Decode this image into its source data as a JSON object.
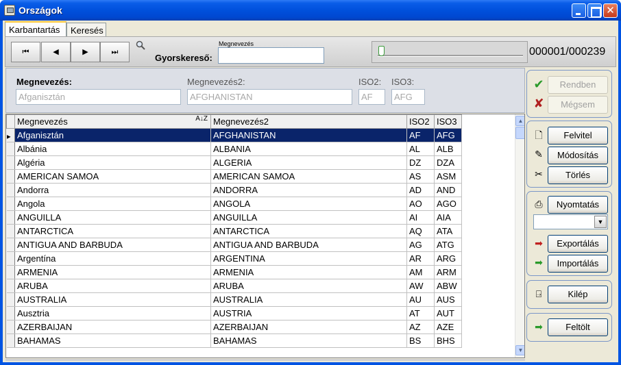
{
  "window": {
    "title": "Országok",
    "colors": {
      "titlebar": "#0054e3",
      "selection": "#0a246a"
    }
  },
  "tabs": [
    {
      "label": "Karbantartás",
      "active": true
    },
    {
      "label": "Keresés",
      "active": false
    }
  ],
  "toolbar": {
    "nav": {
      "first": "⏮",
      "prev": "◀",
      "next": "▶",
      "last": "⏭"
    },
    "search_label": "Gyorskereső:",
    "search_caption": "Megnevezés",
    "search_value": "",
    "record_counter": "000001/000239"
  },
  "detail": {
    "name_label": "Megnevezés:",
    "name_value": "Afganisztán",
    "name2_label": "Megnevezés2:",
    "name2_value": "AFGHANISTAN",
    "iso2_label": "ISO2:",
    "iso2_value": "AF",
    "iso3_label": "ISO3:",
    "iso3_value": "AFG"
  },
  "grid": {
    "columns": [
      "Megnevezés",
      "Megnevezés2",
      "ISO2",
      "ISO3"
    ],
    "sort_icon": "A↓Z",
    "selected_row": 0,
    "rows": [
      [
        "Afganisztán",
        "AFGHANISTAN",
        "AF",
        "AFG"
      ],
      [
        "Albánia",
        "ALBANIA",
        "AL",
        "ALB"
      ],
      [
        "Algéria",
        "ALGERIA",
        "DZ",
        "DZA"
      ],
      [
        "AMERICAN SAMOA",
        "AMERICAN SAMOA",
        "AS",
        "ASM"
      ],
      [
        "Andorra",
        "ANDORRA",
        "AD",
        "AND"
      ],
      [
        "Angola",
        "ANGOLA",
        "AO",
        "AGO"
      ],
      [
        "ANGUILLA",
        "ANGUILLA",
        "AI",
        "AIA"
      ],
      [
        "ANTARCTICA",
        "ANTARCTICA",
        "AQ",
        "ATA"
      ],
      [
        "ANTIGUA AND BARBUDA",
        "ANTIGUA AND BARBUDA",
        "AG",
        "ATG"
      ],
      [
        "Argentína",
        "ARGENTINA",
        "AR",
        "ARG"
      ],
      [
        "ARMENIA",
        "ARMENIA",
        "AM",
        "ARM"
      ],
      [
        "ARUBA",
        "ARUBA",
        "AW",
        "ABW"
      ],
      [
        "AUSTRALIA",
        "AUSTRALIA",
        "AU",
        "AUS"
      ],
      [
        "Ausztria",
        "AUSTRIA",
        "AT",
        "AUT"
      ],
      [
        "AZERBAIJAN",
        "AZERBAIJAN",
        "AZ",
        "AZE"
      ],
      [
        "BAHAMAS",
        "BAHAMAS",
        "BS",
        "BHS"
      ]
    ]
  },
  "actions": {
    "ok": "Rendben",
    "cancel": "Mégsem",
    "new": "Felvitel",
    "edit": "Módosítás",
    "delete": "Törlés",
    "print": "Nyomtatás",
    "export": "Exportálás",
    "import": "Importálás",
    "exit": "Kilép",
    "upload": "Feltölt",
    "print_format_value": ""
  }
}
